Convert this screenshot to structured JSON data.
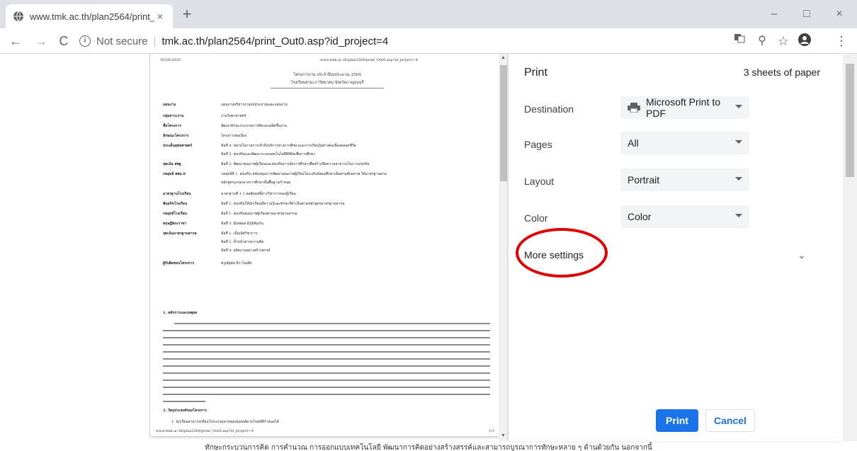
{
  "tab": {
    "title": "www.tmk.ac.th/plan2564/print_O",
    "close": "×"
  },
  "newtab": "+",
  "window": {
    "minimize": "–",
    "maximize": "□",
    "close": "×"
  },
  "nav": {
    "back": "←",
    "forward": "→",
    "reload": "C"
  },
  "omnibox": {
    "info": "i",
    "secure_label": "Not secure",
    "separator": "|",
    "url": "tmk.ac.th/plan2564/print_Out0.asp?id_project=4"
  },
  "toolbar_icons": {
    "zoom": "⚲",
    "star": "☆",
    "menu": "⋮"
  },
  "preview": {
    "date": "10/26/2020",
    "header_url": "www.tmk.ac.th/plan2564/print_Out0.asp?id_project=4",
    "title_line1": "โครงการงาน ประจำปีงบประมาณ 2564",
    "title_line2": "โรงเรียนท่ามะกาวิทยาคม  จังหวัดกาญจนบุรี",
    "fields": [
      {
        "label": "แผนงาน",
        "value": "แผนงานบริหารงานงบประมาณและแผนงาน"
      },
      {
        "label": "กลุ่มสาระงาน",
        "value": "งานวิทยาศาสตร์"
      },
      {
        "label": "ชื่อโครงการ",
        "value": "พัฒนาทักษะกระบวนการคิดและผลิตชิ้นงาน"
      },
      {
        "label": "ลักษณะโครงการ",
        "value": "โครงการต่อเนื่อง"
      },
      {
        "label": "ประเด็นยุทธศาสตร์",
        "value": "ข้อที่ 4. ขยายโอกาสการเข้าถึงบริการทางการศึกษาและการเรียนรู้อย่างต่อเนื่องตลอดชีวิต"
      },
      {
        "label": "",
        "value": "ข้อที่ 5. ส่งเสริมและพัฒนาระบบเทคโนโลยีดิจิทัลเพื่อการศึกษา"
      },
      {
        "label": "จุดเน้น สพฐ.",
        "value": "ข้อที่ 2. พัฒนาคุณภาพผู้เรียนและส่งเสริมการจัดการศึกษาเพื่อสร้างขีดความสามารถในการแข่งขัน"
      },
      {
        "label": "กลยุทธ์ สพม.8",
        "value": "กลยุทธ์ที่ 1. ส่งเสริม สนับสนุนการพัฒนาคุณภาพผู้เรียนในระดับมัธยมศึกษาเต็มตามศักยภาพ ได้มาตรฐานตาม"
      },
      {
        "label": "",
        "value": "หลักสูตรแกนกลางการศึกษาขั้นพื้นฐานกำหนด"
      },
      {
        "label": "มาตรฐานโรงเรียน",
        "value": "มาตรฐานที่ 1.1 ผลสัมฤทธิ์ทางวิชาการของผู้เรียน"
      },
      {
        "label": "พันธกิจโรงเรียน",
        "value": "ข้อที่ 1. ส่งเสริมให้นักเรียนมีความรู้และทักษะที่จำเป็นตามหลักสูตรมาตรฐานสากล"
      },
      {
        "label": "กลยุทธ์โรงเรียน",
        "value": "ข้อที่ 1. ส่งเสริมคุณภาพผู้เรียนตามมาตรฐานสากล"
      },
      {
        "label": "ทฤษฎีพระราชา",
        "value": "ข้อที่ 3. มีเหตุผล มีภูมิคุ้มกัน"
      },
      {
        "label": "จุดเน้นมาตรฐานสากล",
        "value": "ข้อที่ 1. เป็นเลิศวิชาการ"
      },
      {
        "label": "",
        "value": "ข้อที่ 2. ล้ำหน้าทางความคิด"
      },
      {
        "label": "",
        "value": "ข้อที่ 4. ผลิตงานอย่างสร้างสรรค์"
      },
      {
        "label": "ผู้รับผิดชอบโครงการ",
        "value": "ครูณัฐพล จิราโณทัย"
      }
    ],
    "section1": "1. หลักการและเหตุผล",
    "section2": "2. วัตถุประสงค์ของโครงการ",
    "objective1": "1. นักเรียนสามารถเขียนโปรแกรมควบคุมหุ่นยนต์ตามโจทย์ที่กำหนดได้",
    "footer_url": "www.tmk.ac.th/plan2564/print_Out0.asp?id_project=4",
    "footer_page": "1/3"
  },
  "panel": {
    "title": "Print",
    "sheets": "3 sheets of paper",
    "destination_label": "Destination",
    "destination_value": "Microsoft Print to PDF",
    "pages_label": "Pages",
    "pages_value": "All",
    "layout_label": "Layout",
    "layout_value": "Portrait",
    "color_label": "Color",
    "color_value": "Color",
    "more_settings": "More settings",
    "more_chevron": "⌄",
    "print_button": "Print",
    "cancel_button": "Cancel"
  },
  "bottom_text": "ทักษะกระบวนการคิด การคำนวณ การออกแบบเทคโนโลยี พัฒนาการคิดอย่างสร้างสรรค์และสามารถบูรณาการทักษะหลาย ๆ ด้านด้วยกัน นอกจากนี้",
  "colors": {
    "accent": "#1a73e8",
    "highlight_circle": "#e00000",
    "tabstrip": "#dee1e6"
  }
}
